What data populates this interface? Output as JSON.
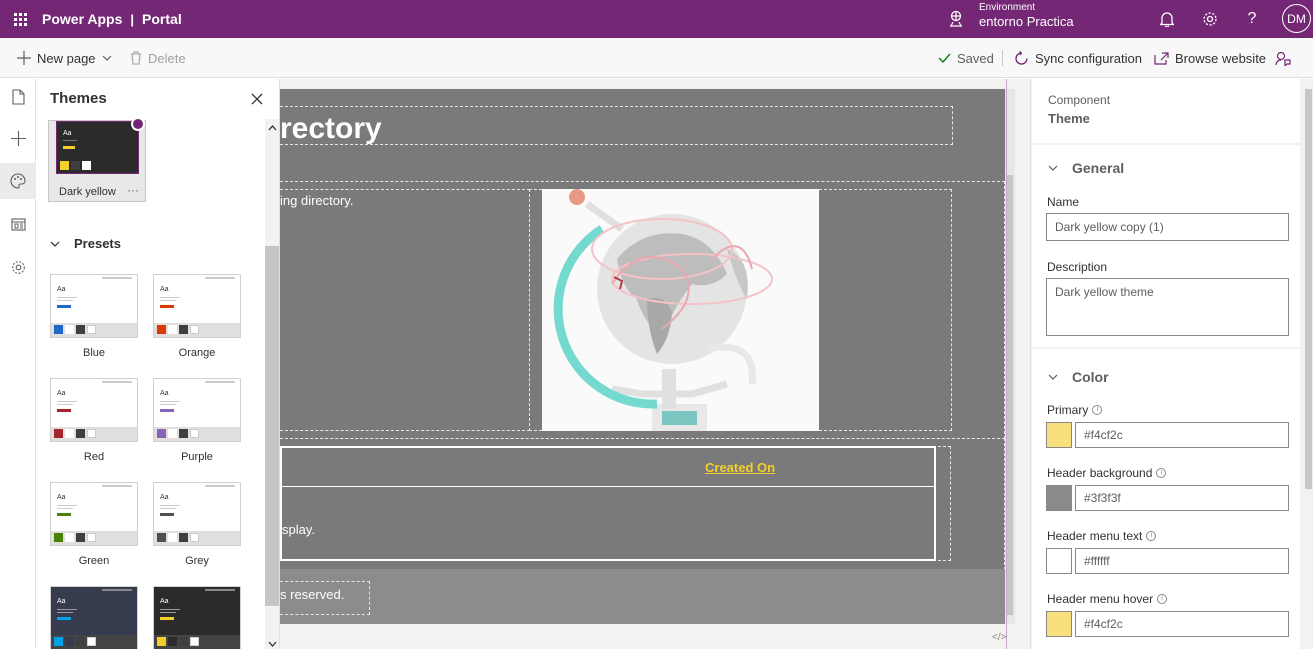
{
  "app": {
    "product": "Power Apps",
    "separator": "|",
    "site": "Portal",
    "environment_label": "Environment",
    "environment_name": "entorno Practica",
    "user_initials": "DM"
  },
  "toolbar": {
    "new_page": "New page",
    "delete": "Delete",
    "saved": "Saved",
    "sync": "Sync configuration",
    "browse": "Browse website"
  },
  "themes_panel": {
    "title": "Themes",
    "custom_theme": {
      "name": "Dark yellow",
      "more": "···",
      "primary": "#f4cf2c",
      "header": "#3f3f3f"
    },
    "presets_title": "Presets",
    "presets": [
      {
        "name": "Blue",
        "primary": "#2266c8",
        "top": "#2266c8",
        "dark": false
      },
      {
        "name": "Orange",
        "primary": "#d83b01",
        "top": "#d83b01",
        "dark": false
      },
      {
        "name": "Red",
        "primary": "#a4262c",
        "top": "#a4262c",
        "dark": false
      },
      {
        "name": "Purple",
        "primary": "#8764b8",
        "top": "#8764b8",
        "dark": false
      },
      {
        "name": "Green",
        "primary": "#498205",
        "top": "#498205",
        "dark": false
      },
      {
        "name": "Grey",
        "primary": "#505050",
        "top": "#505050",
        "dark": false
      },
      {
        "name": "",
        "primary": "#00a2e8",
        "top": "#373b4e",
        "dark": true
      },
      {
        "name": "",
        "primary": "#f4cf2c",
        "top": "#2b2b2b",
        "dark": true
      }
    ]
  },
  "canvas": {
    "heading": "rectory",
    "intro": "ing directory.",
    "column_header": "Created On",
    "empty_text": "splay.",
    "footer_text": "s reserved."
  },
  "properties": {
    "component_label": "Component",
    "component_value": "Theme",
    "general": {
      "title": "General",
      "name_label": "Name",
      "name_value": "Dark yellow copy (1)",
      "description_label": "Description",
      "description_value": "Dark yellow theme"
    },
    "color": {
      "title": "Color",
      "fields": [
        {
          "label": "Primary",
          "value": "#f4cf2c",
          "swatch": "#f9e07e"
        },
        {
          "label": "Header background",
          "value": "#3f3f3f",
          "swatch": "#8a8a8a"
        },
        {
          "label": "Header menu text",
          "value": "#ffffff",
          "swatch": "#ffffff"
        },
        {
          "label": "Header menu hover",
          "value": "#f4cf2c",
          "swatch": "#f9e07e"
        }
      ]
    }
  },
  "colors": {
    "brand": "#742774",
    "accent": "#f4cf2c",
    "saved_check": "#107c10"
  }
}
